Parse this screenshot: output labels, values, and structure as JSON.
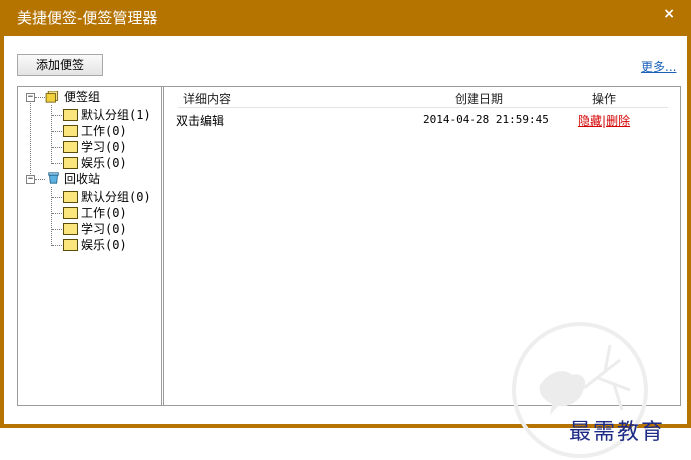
{
  "window": {
    "title": "美捷便签-便签管理器",
    "close_glyph": "×",
    "accent_color": "#b57300"
  },
  "toolbar": {
    "add_button_label": "添加便签",
    "more_link_label": "更多..."
  },
  "tree": {
    "groups": {
      "label": "便签组",
      "expand_glyph": "−",
      "children": [
        "默认分组(1)",
        "工作(0)",
        "学习(0)",
        "娱乐(0)"
      ]
    },
    "recycle": {
      "label": "回收站",
      "expand_glyph": "−",
      "children": [
        "默认分组(0)",
        "工作(0)",
        "学习(0)",
        "娱乐(0)"
      ]
    }
  },
  "table": {
    "columns": [
      "详细内容",
      "创建日期",
      "操作"
    ],
    "rows": [
      {
        "content": "双击编辑",
        "date": "2014-04-28 21:59:45",
        "hide": "隐藏",
        "separator": "|",
        "delete": "删除"
      }
    ]
  },
  "watermark": {
    "text": "最需教育",
    "icon": "bird-on-branch-logo"
  }
}
